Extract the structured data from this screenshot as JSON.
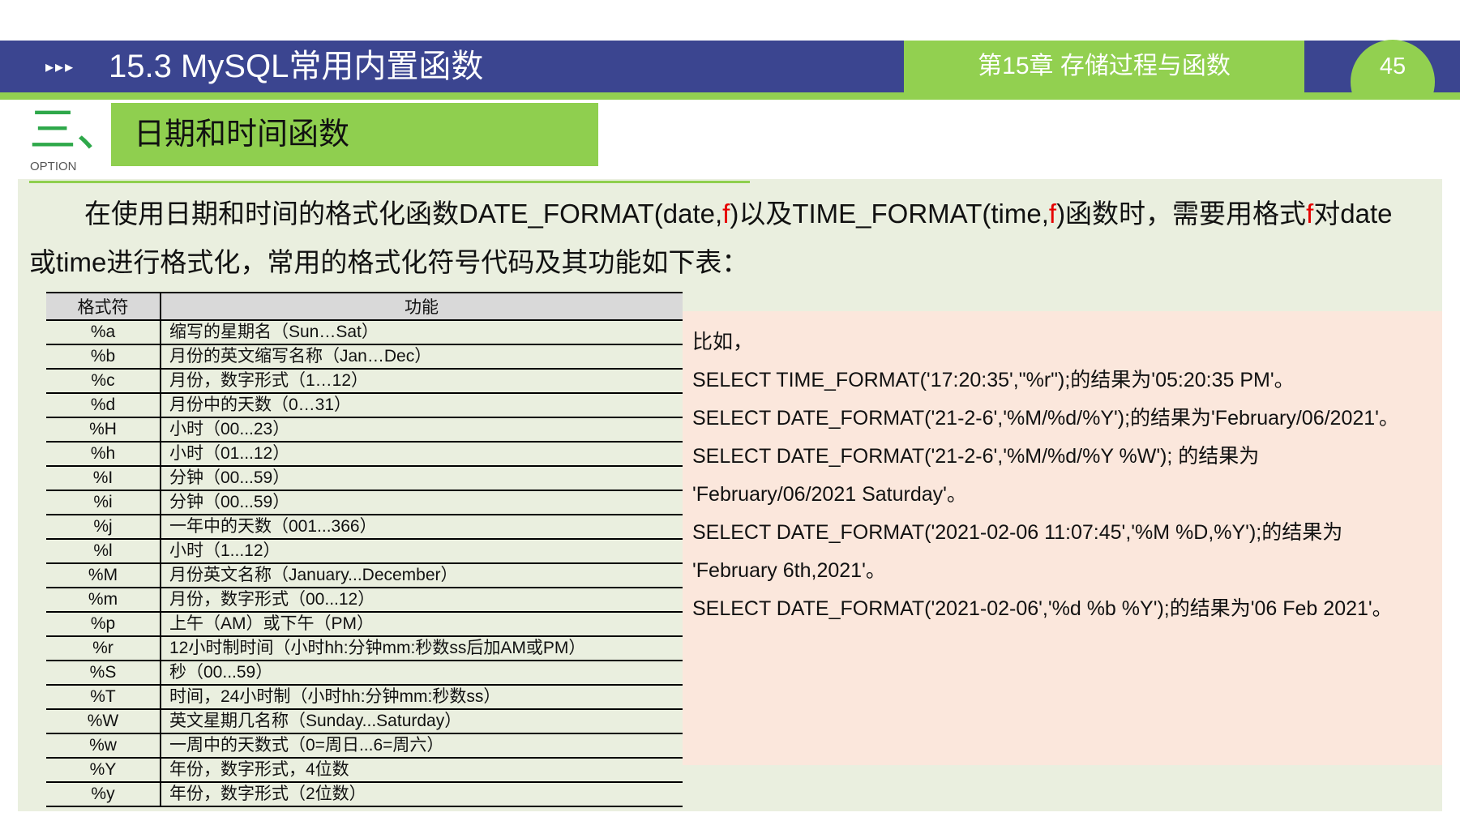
{
  "header": {
    "arrows": "▸▸▸",
    "title": "15.3 MySQL常用内置函数",
    "chapter": "第15章 存储过程与函数",
    "page_number": "45"
  },
  "section": {
    "number": "三、",
    "option_label": "OPTION",
    "title": "日期和时间函数"
  },
  "intro": {
    "p1": "在使用日期和时间的格式化函数DATE_FORMAT(date,",
    "f1": "f",
    "p2": ")以及TIME_FORMAT(time,",
    "f2": "f",
    "p3": ")函数时，需要用格式",
    "f3": "f",
    "p4": "对date",
    "line2": "或time进行格式化，常用的格式化符号代码及其功能如下表："
  },
  "table": {
    "headers": [
      "格式符",
      "功能"
    ],
    "rows": [
      [
        "%a",
        "缩写的星期名（Sun…Sat）"
      ],
      [
        "%b",
        "月份的英文缩写名称（Jan…Dec）"
      ],
      [
        "%c",
        "月份，数字形式（1…12）"
      ],
      [
        "%d",
        "月份中的天数（0…31）"
      ],
      [
        "%H",
        "小时（00...23）"
      ],
      [
        "%h",
        "小时（01...12）"
      ],
      [
        "%I",
        "分钟（00...59）"
      ],
      [
        "%i",
        "分钟（00...59）"
      ],
      [
        "%j",
        "一年中的天数（001...366）"
      ],
      [
        "%l",
        "小时（1...12）"
      ],
      [
        "%M",
        "月份英文名称（January...December）"
      ],
      [
        "%m",
        "月份，数字形式（00...12）"
      ],
      [
        "%p",
        "上午（AM）或下午（PM）"
      ],
      [
        "%r",
        "12小时制时间（小时hh:分钟mm:秒数ss后加AM或PM）"
      ],
      [
        "%S",
        "秒（00...59）"
      ],
      [
        "%T",
        "时间，24小时制（小时hh:分钟mm:秒数ss）"
      ],
      [
        "%W",
        "英文星期几名称（Sunday...Saturday）"
      ],
      [
        "%w",
        "一周中的天数式（0=周日...6=周六）"
      ],
      [
        "%Y",
        "年份，数字形式，4位数"
      ],
      [
        "%y",
        "年份，数字形式（2位数）"
      ]
    ]
  },
  "examples": [
    "比如，",
    "SELECT TIME_FORMAT('17:20:35',\"%r\");的结果为'05:20:35 PM'。",
    "SELECT DATE_FORMAT('21-2-6','%M/%d/%Y');的结果为'February/06/2021'。",
    "SELECT DATE_FORMAT('21-2-6','%M/%d/%Y  %W'); 的结果为",
    "'February/06/2021  Saturday'。",
    "SELECT DATE_FORMAT('2021-02-06 11:07:45','%M %D,%Y');的结果为",
    "'February 6th,2021'。",
    "SELECT DATE_FORMAT('2021-02-06','%d %b %Y');的结果为'06 Feb 2021'。"
  ],
  "colors": {
    "header_blue": "#3b4590",
    "accent_green": "#92d050",
    "panel_bg": "#eaefdf",
    "example_bg": "#fbe7dc",
    "highlight_red": "#e60000"
  }
}
